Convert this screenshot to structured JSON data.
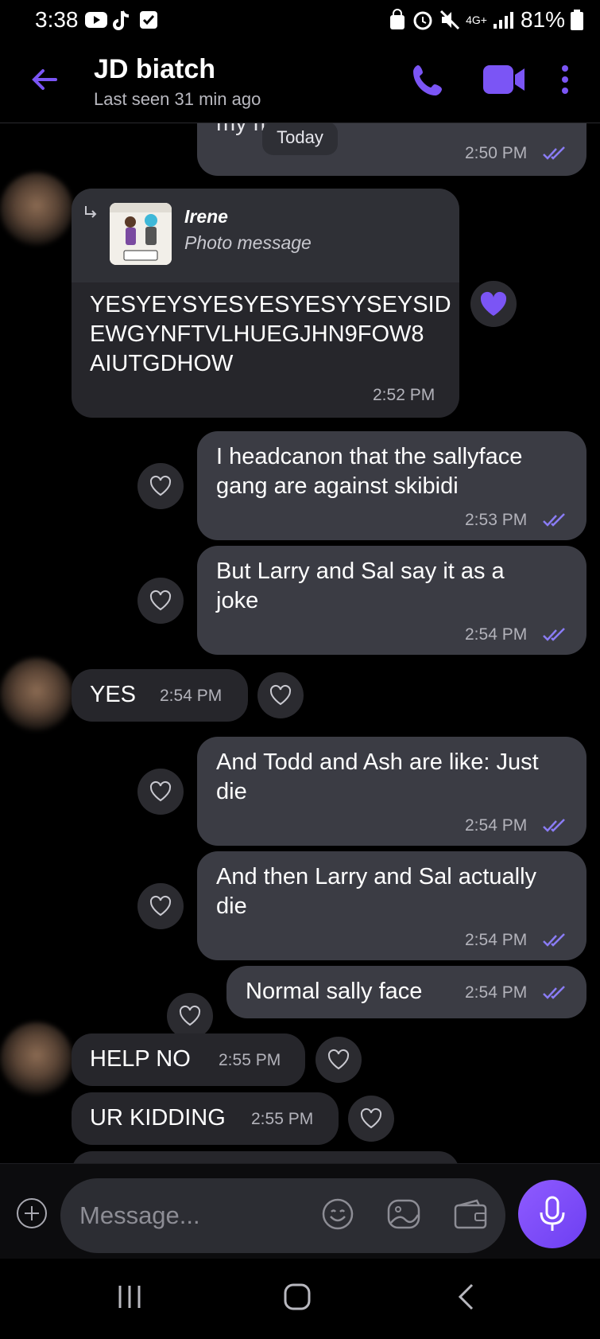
{
  "status_bar": {
    "time": "3:38",
    "network": "4G+",
    "battery": "81%"
  },
  "header": {
    "title": "JD biatch",
    "subtitle": "Last seen 31 min ago"
  },
  "chat": {
    "date_chip": "Today",
    "cutoff_msg": {
      "text": "my mind",
      "time": "2:50 PM"
    },
    "reply_msg": {
      "quoted_name": "Irene",
      "quoted_type": "Photo message",
      "text_line1": "YESYEYSYESYESYESYYSEYSID",
      "text_line2": "EWGYNFTVLHUEGJHN9FOW8",
      "text_line3": "AIUTGDHOW",
      "time": "2:52 PM"
    },
    "messages": [
      {
        "side": "out",
        "line1": "I headcanon that the sallyface",
        "line2": "gang are against skibidi",
        "time": "2:53 PM"
      },
      {
        "side": "out",
        "line1": "But Larry and Sal say it as a",
        "line2": "joke",
        "time": "2:54 PM"
      },
      {
        "side": "in",
        "text": "YES",
        "time": "2:54 PM"
      },
      {
        "side": "out",
        "line1": "And Todd and Ash are like: Just",
        "line2": "die",
        "time": "2:54 PM"
      },
      {
        "side": "out",
        "line1": "And then Larry and Sal actually",
        "line2": "die",
        "time": "2:54 PM"
      },
      {
        "side": "out",
        "text": "Normal sally face",
        "time": "2:54 PM"
      },
      {
        "side": "in",
        "text": "HELP NO",
        "time": "2:55 PM"
      },
      {
        "side": "in",
        "text": "UR KIDDING",
        "time": "2:55 PM"
      }
    ]
  },
  "composer": {
    "placeholder": "Message..."
  },
  "colors": {
    "accent": "#7b55f5",
    "outgoing_bubble": "#3b3c44",
    "incoming_bubble": "#26262b",
    "ticks": "#8a7cf5"
  }
}
